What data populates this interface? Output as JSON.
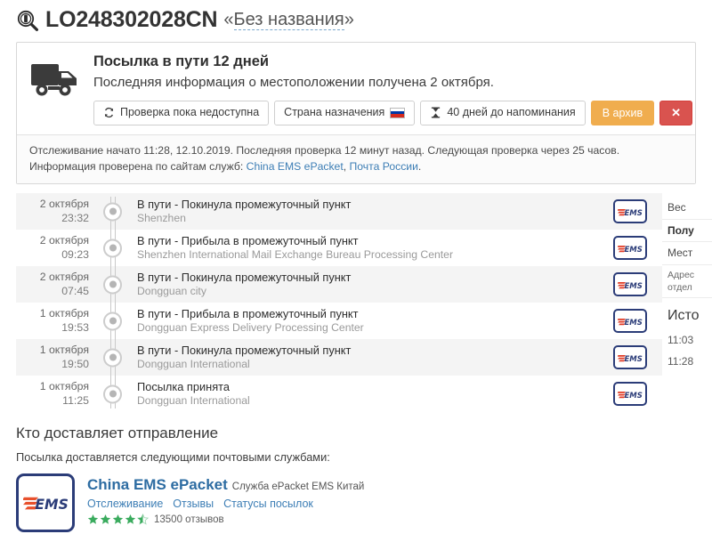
{
  "header": {
    "icon": "package-magnifier-icon",
    "tracking_number": "LO248302028CN",
    "alias_open": "«",
    "alias_text": "Без названия",
    "alias_close": "»"
  },
  "status_panel": {
    "icon": "truck-icon",
    "title": "Посылка в пути 12 дней",
    "subtitle": "Последняя информация о местоположении получена 2 октября.",
    "buttons": {
      "refresh": {
        "icon": "refresh-icon",
        "label": "Проверка пока недоступна"
      },
      "country": {
        "label": "Страна назначения",
        "icon": "russia-flag-icon"
      },
      "reminder": {
        "icon": "hourglass-icon",
        "label": "40 дней до напоминания"
      },
      "archive": {
        "label": "В архив"
      },
      "delete": {
        "label": "✕"
      }
    },
    "info": {
      "line1": "Отслеживание начато 11:28, 12.10.2019. Последняя проверка 12 минут назад. Следующая проверка через 25 часов.",
      "line2_prefix": "Информация проверена по сайтам служб: ",
      "link1": "China EMS ePacket",
      "separator": ", ",
      "link2": "Почта России",
      "line2_suffix": "."
    }
  },
  "timeline": {
    "carrier_badge": "ems-logo-icon",
    "events": [
      {
        "date": "2 октября",
        "time": "23:32",
        "status": "В пути - Покинула промежуточный пункт",
        "place": "Shenzhen"
      },
      {
        "date": "2 октября",
        "time": "09:23",
        "status": "В пути - Прибыла в промежуточный пункт",
        "place": "Shenzhen International Mail Exchange Bureau Processing Center"
      },
      {
        "date": "2 октября",
        "time": "07:45",
        "status": "В пути - Покинула промежуточный пункт",
        "place": "Dongguan city"
      },
      {
        "date": "1 октября",
        "time": "19:53",
        "status": "В пути - Прибыла в промежуточный пункт",
        "place": "Dongguan Express Delivery Processing Center"
      },
      {
        "date": "1 октября",
        "time": "19:50",
        "status": "В пути - Покинула промежуточный пункт",
        "place": "Dongguan International"
      },
      {
        "date": "1 октября",
        "time": "11:25",
        "status": "Посылка принята",
        "place": "Dongguan International"
      }
    ]
  },
  "sidebar": {
    "weight_label": "Вес",
    "recipient_label": "Полу",
    "place_label": "Мест",
    "address_line1": "Адрес",
    "address_line2": "отдел",
    "history_heading": "Исто",
    "history_times": [
      "11:03",
      "11:28"
    ]
  },
  "delivery": {
    "heading": "Кто доставляет отправление",
    "subheading": "Посылка доставляется следующими почтовыми службами:",
    "carrier": {
      "logo": "ems-logo-icon",
      "name": "China EMS ePacket",
      "description": "Служба ePacket EMS Китай",
      "links": [
        "Отслеживание",
        "Отзывы",
        "Статусы посылок"
      ],
      "rating": 4.5,
      "rating_stars_total": 5,
      "reviews_text": "13500 отзывов"
    }
  },
  "colors": {
    "link": "#3d7eb5",
    "archive_button": "#f0ad4e",
    "delete_button": "#d9534f",
    "carrier_name": "#2d6ca2",
    "star": "#3aab5e",
    "ems_blue": "#2b3c78",
    "ems_red": "#e03a24"
  }
}
